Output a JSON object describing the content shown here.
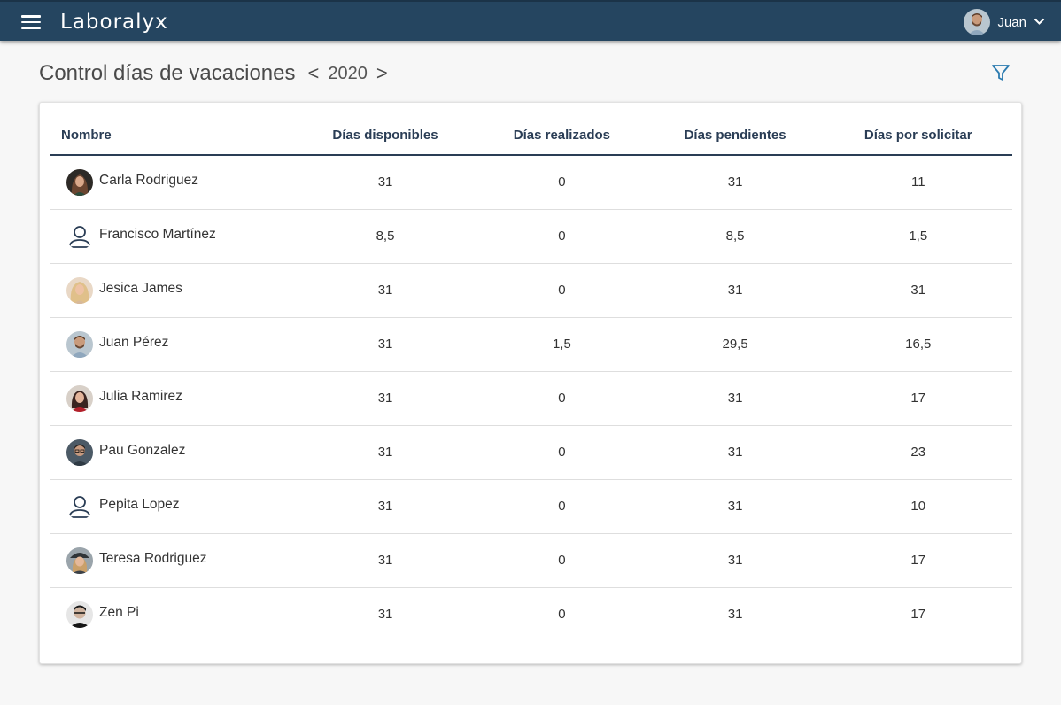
{
  "app": {
    "brand": "Laboralyx",
    "user_name": "Juan"
  },
  "page": {
    "title": "Control días de vacaciones",
    "prev_arrow": "<",
    "year": "2020",
    "next_arrow": ">"
  },
  "colors": {
    "topbar": "#254560",
    "header_text": "#2a3d55",
    "filter_icon": "#2b7bb0"
  },
  "table": {
    "columns": [
      "Nombre",
      "Días disponibles",
      "Días realizados",
      "Días pendientes",
      "Días por solicitar"
    ],
    "rows": [
      {
        "name": "Carla Rodriguez",
        "avatar": "photo-woman-dark-hair",
        "disponibles": "31",
        "realizados": "0",
        "pendientes": "31",
        "por_solicitar": "11"
      },
      {
        "name": "Francisco Martínez",
        "avatar": "user-outline-icon",
        "disponibles": "8,5",
        "realizados": "0",
        "pendientes": "8,5",
        "por_solicitar": "1,5"
      },
      {
        "name": "Jesica James",
        "avatar": "photo-woman-blonde",
        "disponibles": "31",
        "realizados": "0",
        "pendientes": "31",
        "por_solicitar": "31"
      },
      {
        "name": "Juan Pérez",
        "avatar": "photo-man-beard",
        "disponibles": "31",
        "realizados": "1,5",
        "pendientes": "29,5",
        "por_solicitar": "16,5"
      },
      {
        "name": "Julia Ramirez",
        "avatar": "photo-woman-red-top",
        "disponibles": "31",
        "realizados": "0",
        "pendientes": "31",
        "por_solicitar": "17"
      },
      {
        "name": "Pau Gonzalez",
        "avatar": "photo-man-glasses",
        "disponibles": "31",
        "realizados": "0",
        "pendientes": "31",
        "por_solicitar": "23"
      },
      {
        "name": "Pepita Lopez",
        "avatar": "user-outline-icon",
        "disponibles": "31",
        "realizados": "0",
        "pendientes": "31",
        "por_solicitar": "10"
      },
      {
        "name": "Teresa Rodriguez",
        "avatar": "photo-woman-hat",
        "disponibles": "31",
        "realizados": "0",
        "pendientes": "31",
        "por_solicitar": "17"
      },
      {
        "name": "Zen Pi",
        "avatar": "photo-person-dark",
        "disponibles": "31",
        "realizados": "0",
        "pendientes": "31",
        "por_solicitar": "17"
      }
    ]
  }
}
